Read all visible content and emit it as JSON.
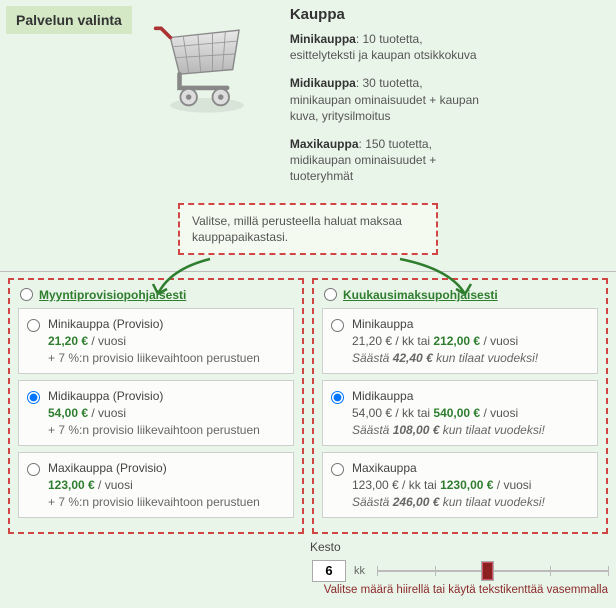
{
  "header": {
    "badge": "Palvelun valinta"
  },
  "product": {
    "title": "Kauppa",
    "tiers": [
      {
        "name": "Minikauppa",
        "desc": ": 10 tuotetta, esittelyteksti ja kaupan otsikkokuva"
      },
      {
        "name": "Midikauppa",
        "desc": ": 30 tuotetta, minikaupan ominaisuudet + kaupan kuva, yritysilmoitus"
      },
      {
        "name": "Maxikauppa",
        "desc": ": 150 tuotetta, midikaupan  ominaisuudet + tuoteryhmät"
      }
    ]
  },
  "hint_primary": "Valitse, millä perusteella haluat maksaa kauppapaikastasi.",
  "columns": {
    "left": {
      "title": "Myyntiprovisiopohjaisesti",
      "options": [
        {
          "label": "Minikauppa (Provisio)",
          "price": "21,20 €",
          "per": " / vuosi",
          "extra": "+ 7 %:n provisio liikevaihtoon perustuen",
          "selected": false
        },
        {
          "label": "Midikauppa (Provisio)",
          "price": "54,00 €",
          "per": " / vuosi",
          "extra": "+ 7 %:n provisio liikevaihtoon perustuen",
          "selected": true
        },
        {
          "label": "Maxikauppa (Provisio)",
          "price": "123,00 €",
          "per": " / vuosi",
          "extra": "+ 7 %:n provisio liikevaihtoon perustuen",
          "selected": false
        }
      ]
    },
    "right": {
      "title": "Kuukausimaksupohjaisesti",
      "options": [
        {
          "label": "Minikauppa",
          "price_prefix": "21,20 € / kk tai ",
          "price": "212,00 €",
          "per": " / vuosi",
          "save_prefix": "Säästä ",
          "save_amount": "42,40 €",
          "save_suffix": " kun tilaat vuodeksi!",
          "selected": false
        },
        {
          "label": "Midikauppa",
          "price_prefix": "54,00 € / kk tai ",
          "price": "540,00 €",
          "per": " / vuosi",
          "save_prefix": "Säästä ",
          "save_amount": "108,00 €",
          "save_suffix": " kun tilaat vuodeksi!",
          "selected": true
        },
        {
          "label": "Maxikauppa",
          "price_prefix": "123,00 € / kk tai ",
          "price": "1230,00 €",
          "per": " / vuosi",
          "save_prefix": "Säästä ",
          "save_amount": "246,00 €",
          "save_suffix": " kun tilaat vuodeksi!",
          "selected": false
        }
      ]
    }
  },
  "duration": {
    "label": "Kesto",
    "value": "6",
    "unit": "kk",
    "min": 1,
    "max": 12,
    "slider_pos_pct": 45
  },
  "hint_bottom": "Valitse määrä hiirellä tai käytä tekstikenttää vasemmalla"
}
